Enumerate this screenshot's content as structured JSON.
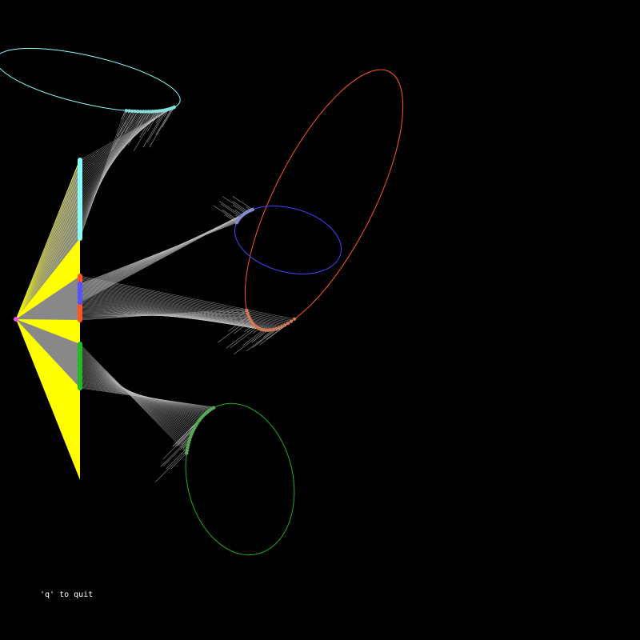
{
  "window": {
    "background": "#000000"
  },
  "hint": {
    "text": "'q' to quit",
    "color": "#ffffff"
  },
  "viewer": {
    "eye_color": "#ff44ff",
    "frustum_color": "#ffff00",
    "projected_ray_color": "#888888",
    "scene_ray_color": "#bbbbbb"
  },
  "ellipses": [
    {
      "name": "cyan",
      "color": "#88ffff",
      "projection_color": "#88ffff"
    },
    {
      "name": "orange",
      "color": "#ff5522",
      "projection_color": "#ff5522"
    },
    {
      "name": "blue",
      "color": "#4444ff",
      "projection_color": "#5555ff"
    },
    {
      "name": "green",
      "color": "#22aa22",
      "projection_color": "#22bb22"
    }
  ]
}
